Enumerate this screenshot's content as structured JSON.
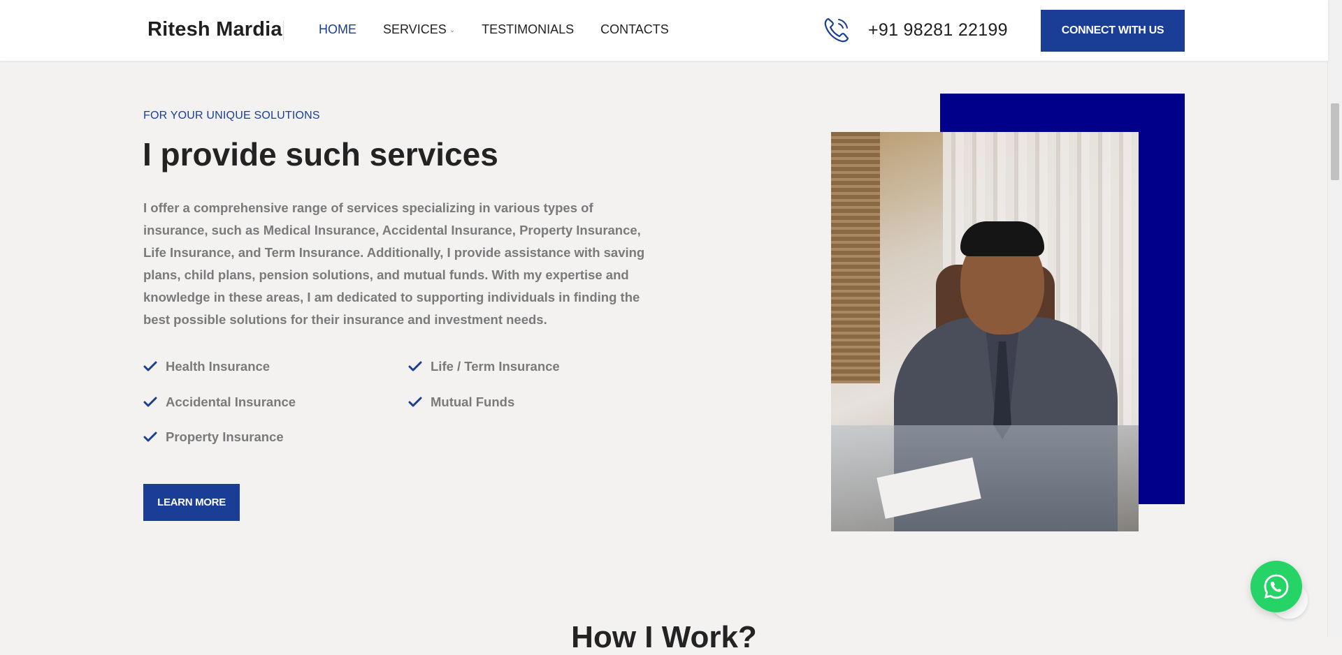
{
  "header": {
    "brand": "Ritesh Mardia",
    "nav": [
      {
        "label": "HOME",
        "active": true
      },
      {
        "label": "SERVICES",
        "has_dropdown": true
      },
      {
        "label": "TESTIMONIALS"
      },
      {
        "label": "CONTACTS"
      }
    ],
    "phone_icon": "phone-icon",
    "phone": "+91 98281 22199",
    "cta": "CONNECT WITH US"
  },
  "section": {
    "eyebrow": "FOR YOUR UNIQUE SOLUTIONS",
    "title": "I provide such services",
    "description": "I offer a comprehensive range of services specializing in various types of insurance, such as Medical Insurance, Accidental Insurance, Property Insurance, Life Insurance, and Term Insurance. Additionally, I provide assistance with saving plans, child plans, pension solutions, and mutual funds. With my expertise and knowledge in these areas, I am dedicated to supporting individuals in finding the best possible solutions for their insurance and investment needs.",
    "features_left": [
      "Health Insurance",
      "Accidental Insurance",
      "Property Insurance"
    ],
    "features_right": [
      "Life / Term Insurance",
      "Mutual Funds"
    ],
    "button": "LEARN MORE"
  },
  "next_section": {
    "heading": "How I Work?"
  },
  "colors": {
    "accent": "#1a3d96",
    "block": "#00008b",
    "whatsapp": "#25d366",
    "background": "#f3f2f1"
  },
  "floating": {
    "whatsapp_icon": "whatsapp-icon"
  }
}
